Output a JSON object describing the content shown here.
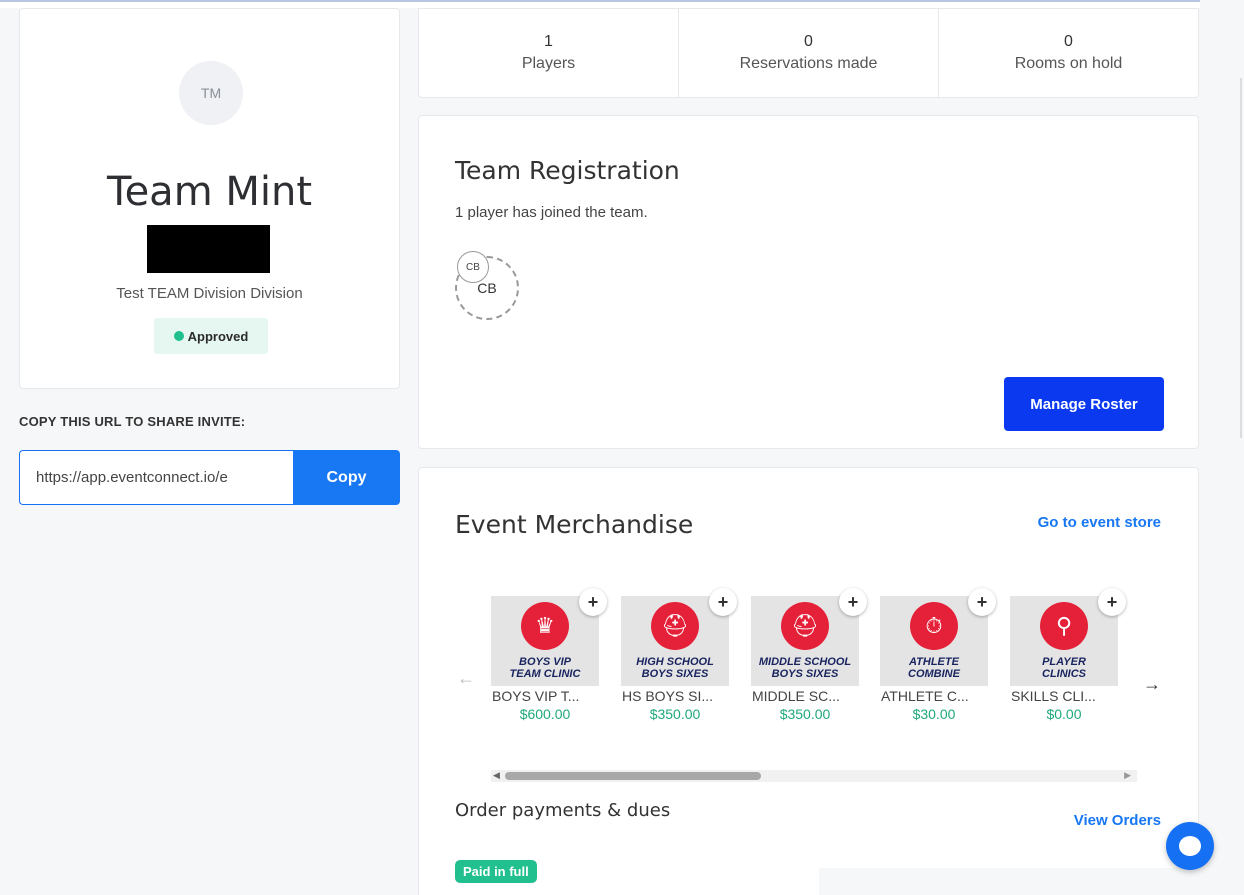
{
  "team": {
    "avatar_initials": "TM",
    "name": "Team Mint",
    "division": "Test TEAM Division Division",
    "status": "Approved"
  },
  "share": {
    "label": "COPY THIS URL TO SHARE INVITE:",
    "url": "https://app.eventconnect.io/e",
    "copy_label": "Copy"
  },
  "stats": [
    {
      "value": "1",
      "label": "Players"
    },
    {
      "value": "0",
      "label": "Reservations made"
    },
    {
      "value": "0",
      "label": "Rooms on hold"
    }
  ],
  "registration": {
    "title": "Team Registration",
    "subtitle": "1 player has joined the team.",
    "player_initials": "CB",
    "manage_label": "Manage Roster"
  },
  "merchandise": {
    "title": "Event Merchandise",
    "store_link": "Go to event store",
    "products": [
      {
        "name": "BOYS VIP T...",
        "price": "$600.00",
        "image_text_1": "BOYS VIP",
        "image_text_2": "TEAM CLINIC",
        "icon": "crown-icon",
        "glyph": "♛"
      },
      {
        "name": "HS BOYS SI...",
        "price": "$350.00",
        "image_text_1": "HIGH SCHOOL",
        "image_text_2": "BOYS SIXES",
        "icon": "helmet-icon",
        "glyph": "⛑"
      },
      {
        "name": "MIDDLE SC...",
        "price": "$350.00",
        "image_text_1": "MIDDLE SCHOOL",
        "image_text_2": "BOYS SIXES",
        "icon": "helmet-icon",
        "glyph": "⛑"
      },
      {
        "name": "ATHLETE C...",
        "price": "$30.00",
        "image_text_1": "ATHLETE",
        "image_text_2": "COMBINE",
        "icon": "stopwatch-icon",
        "glyph": "⏱"
      },
      {
        "name": "SKILLS CLI...",
        "price": "$0.00",
        "image_text_1": "PLAYER",
        "image_text_2": "CLINICS",
        "icon": "lacrosse-stick-icon",
        "glyph": "⚲"
      }
    ]
  },
  "orders": {
    "title": "Order payments & dues",
    "view_link": "View Orders",
    "status": "Paid in full"
  },
  "icons": {
    "prev": "←",
    "next": "→",
    "plus": "+"
  },
  "colors": {
    "primary": "#1877f2",
    "manage": "#0a39f0",
    "approved": "#20c08e",
    "price": "#20a87c"
  }
}
